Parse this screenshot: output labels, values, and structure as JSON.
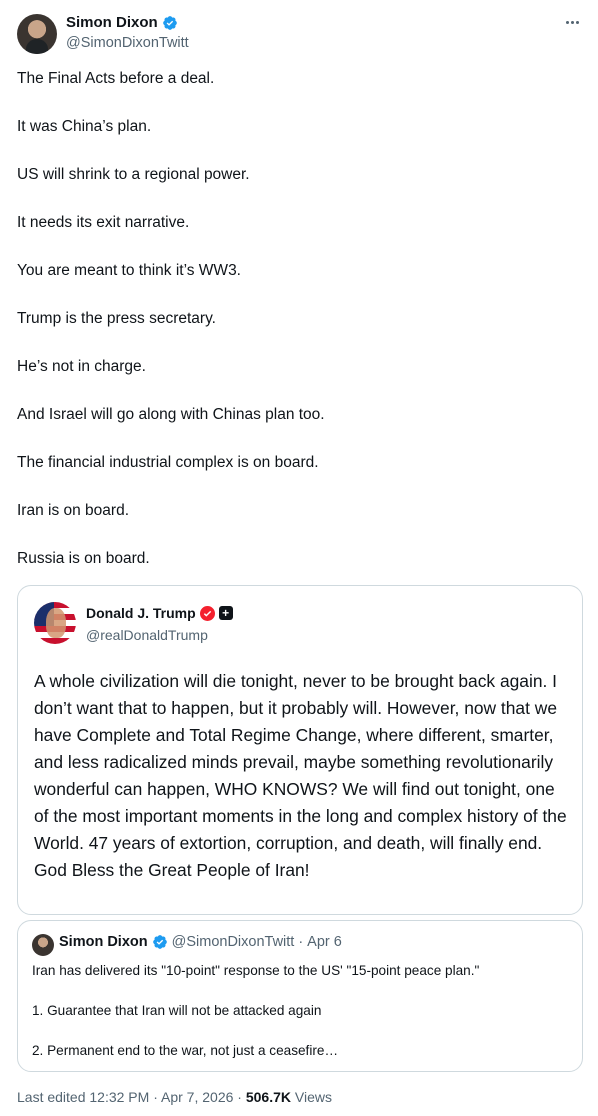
{
  "tweet": {
    "author": {
      "name": "Simon Dixon",
      "handle": "@SimonDixonTwitt",
      "verified": true
    },
    "lines": [
      "The Final Acts before a deal.",
      "It was China’s plan.",
      "US will shrink to a regional power.",
      "It needs its exit narrative.",
      "You are meant to think it’s WW3.",
      "Trump is the press secretary.",
      "He’s not in charge.",
      "And Israel will go along with Chinas plan too.",
      "The financial industrial complex is on board.",
      "Iran is on board.",
      "Russia is on board."
    ]
  },
  "quote": {
    "author": {
      "name": "Donald J. Trump",
      "handle": "@realDonaldTrump"
    },
    "text": "A whole civilization will die tonight, never to be brought back again. I don’t want that to happen, but it probably will. However, now that we have Complete and Total Regime Change, where different, smarter, and less radicalized minds prevail, maybe something revolutionarily wonderful can happen, WHO KNOWS? We will find out tonight, one of the most important moments in the long and complex history of the World. 47 years of extortion, corruption, and death, will finally end. God Bless the Great People of Iran!"
  },
  "nested_quote": {
    "author": {
      "name": "Simon Dixon",
      "handle": "@SimonDixonTwitt",
      "separator": "·",
      "date": "Apr 6"
    },
    "lines": [
      "Iran has delivered its \"10-point\" response to the US' \"15-point peace plan.\"",
      "1. Guarantee that Iran will not be attacked again",
      "2. Permanent end to the war, not just a ceasefire…"
    ]
  },
  "footer": {
    "edited": "Last edited 12:32 PM",
    "separator": "·",
    "date": "Apr 7, 2026",
    "views_count": "506.7K",
    "views_label": "Views"
  },
  "colors": {
    "verified": "#1d9bf0",
    "government_badge": "#f4212e",
    "secondary_text": "#536471",
    "border": "#cfd9de"
  },
  "icons": {
    "more": "more-horizontal-icon",
    "verified": "verified-badge-icon",
    "government": "government-badge-icon",
    "square": "square-badge-icon"
  }
}
